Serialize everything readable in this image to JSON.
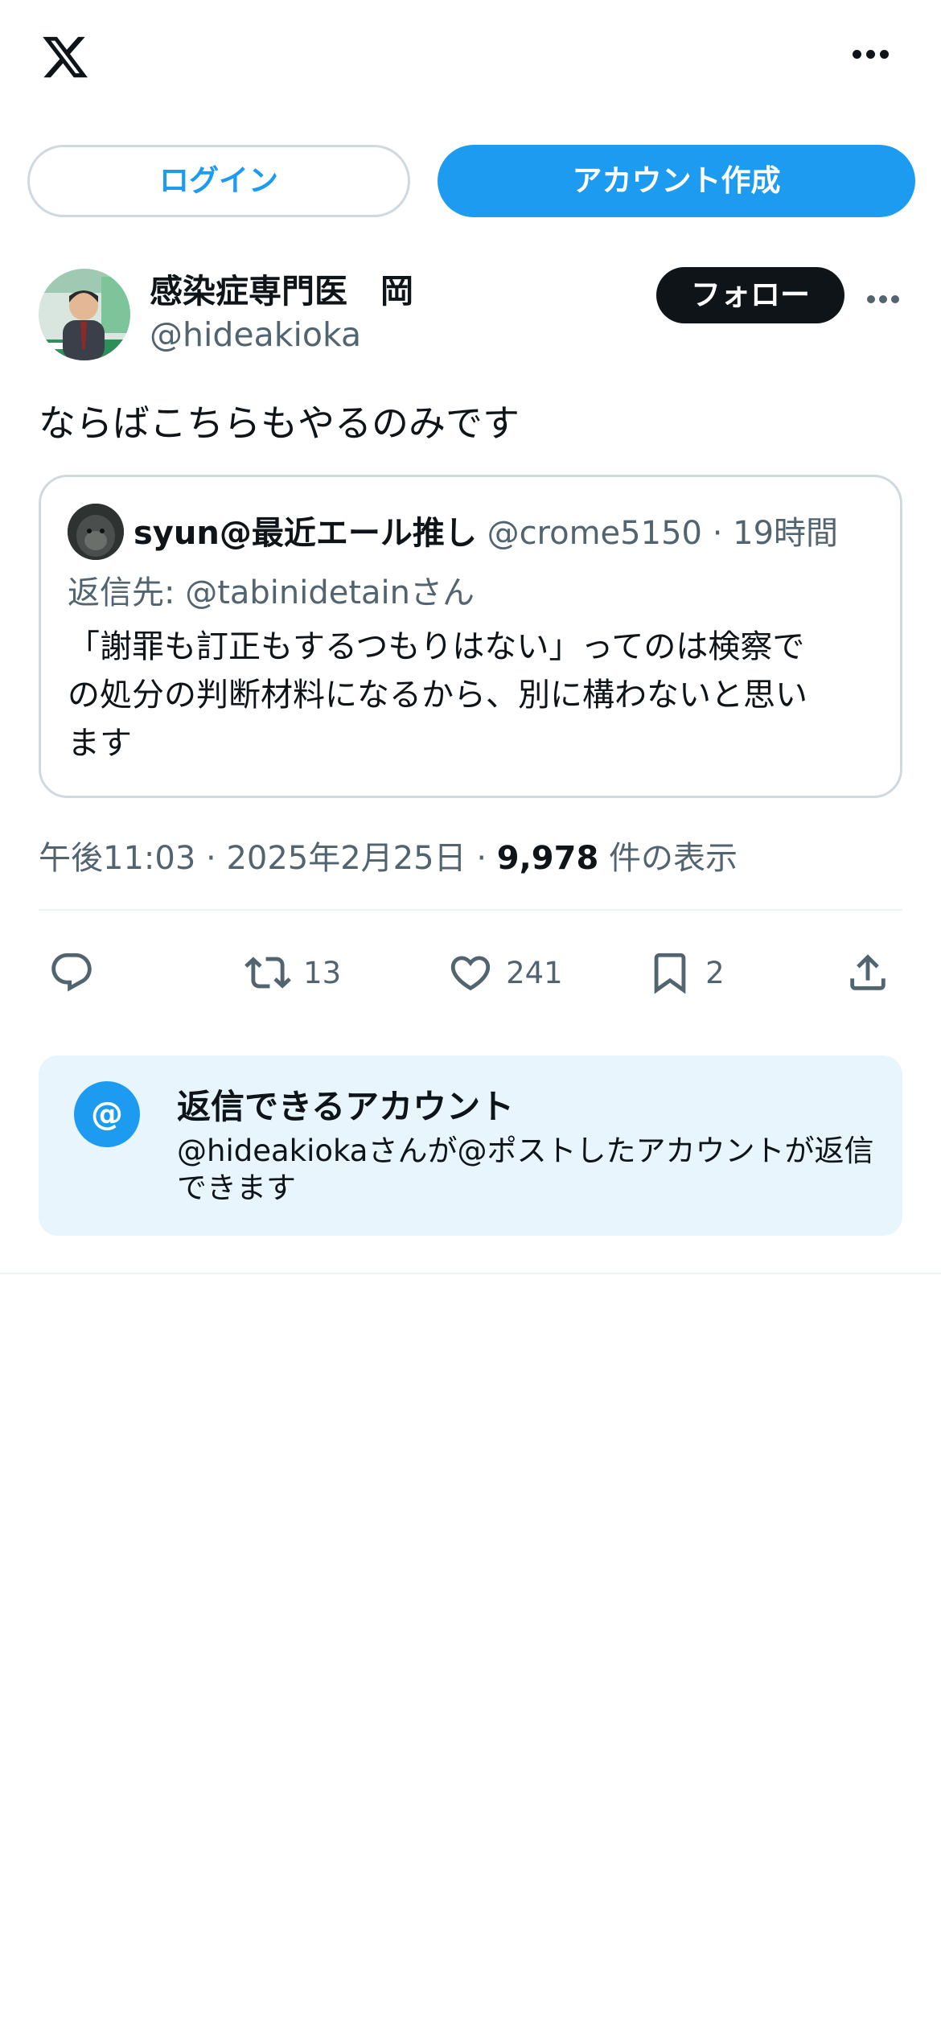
{
  "header": {
    "logo_icon": "x-logo-icon",
    "more_icon": "more-horizontal-icon"
  },
  "auth": {
    "login_label": "ログイン",
    "signup_label": "アカウント作成"
  },
  "post": {
    "author_name": "感染症専門医　岡",
    "author_handle": "@hideakioka",
    "follow_label": "フォロー",
    "text": "ならばこちらもやるのみです",
    "quote": {
      "name": "syun@最近エール推し",
      "handle": "@crome5150",
      "separator": "·",
      "time": "19時間",
      "reply_to": "返信先: @tabinidetainさん",
      "body_lines": [
        "「謝罪も訂正もするつもりはない」ってのは検察で",
        "の処分の判断材料になるから、別に構わないと思い",
        "ます"
      ]
    },
    "meta": {
      "time": "午後11:03",
      "date": "2025年2月25日",
      "separator": "·",
      "views": "9,978",
      "views_label": "件の表示"
    },
    "actions": {
      "reply_count": "",
      "retweet_count": "13",
      "like_count": "241",
      "bookmark_count": "2"
    }
  },
  "reply_settings": {
    "icon_char": "@",
    "title": "返信できるアカウント",
    "description": "@hideakiokaさんが@ポストしたアカウントが返信できます"
  },
  "colors": {
    "accent": "#1d9bf0",
    "text": "#0f1419",
    "secondary": "#536471",
    "border": "#cfd9de",
    "info_bg": "#e8f5fd"
  }
}
